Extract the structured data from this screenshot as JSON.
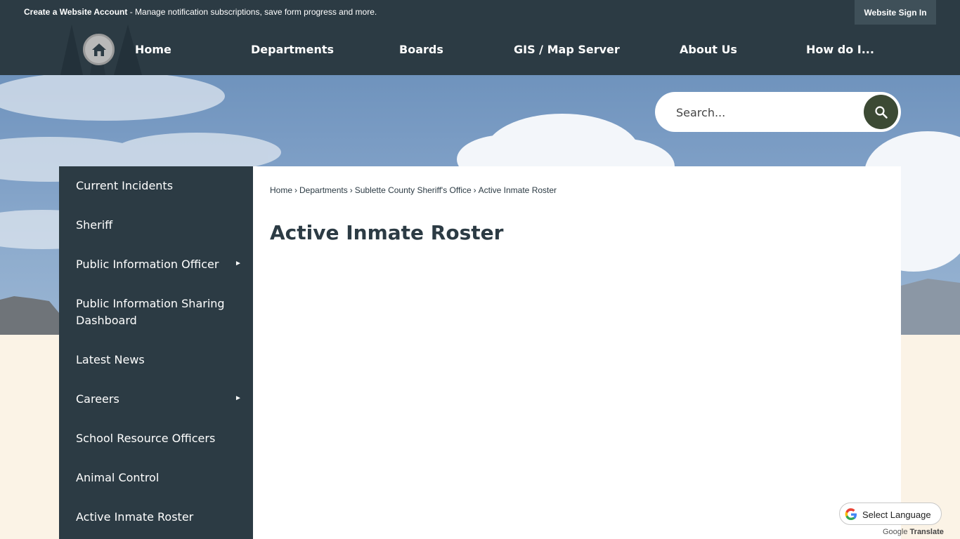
{
  "topbar": {
    "account_link": "Create a Website Account",
    "account_desc": " - Manage notification subscriptions, save form progress and more.",
    "signin": "Website Sign In"
  },
  "nav": {
    "items": [
      "Home",
      "Departments",
      "Boards",
      "GIS / Map Server",
      "About Us",
      "How do I..."
    ]
  },
  "search": {
    "placeholder": "Search..."
  },
  "sidebar": {
    "items": [
      "Current Incidents",
      "Sheriff",
      "Public Information Officer",
      "Public Information Sharing Dashboard",
      "Latest News",
      "Careers",
      "School Resource Officers",
      "Animal Control",
      "Active Inmate Roster"
    ]
  },
  "breadcrumb": [
    "Home",
    "Departments",
    "Sublette County Sheriff's Office",
    "Active Inmate Roster"
  ],
  "page": {
    "title": "Active Inmate Roster"
  },
  "translate": {
    "label": "Select Language",
    "powered_google": "Google",
    "powered_translate": "Translate"
  },
  "colors": {
    "nav_bg": "#2c3b44",
    "page_bg": "#fbf3e6",
    "search_btn": "#3c4a34"
  }
}
